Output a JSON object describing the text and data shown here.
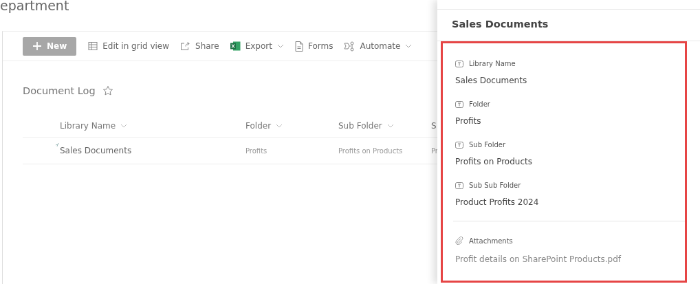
{
  "page_title": "epartment",
  "toolbar": [
    {
      "kind": "new",
      "label": "New"
    },
    {
      "kind": "grid",
      "label": "Edit in grid view"
    },
    {
      "kind": "share",
      "label": "Share"
    },
    {
      "kind": "excel",
      "label": "Export",
      "dropdown": true
    },
    {
      "kind": "forms",
      "label": "Forms"
    },
    {
      "kind": "automate",
      "label": "Automate",
      "dropdown": true
    }
  ],
  "list": {
    "title": "Document Log",
    "favorite": false,
    "columns": [
      {
        "label": "Library Name",
        "sortable": true
      },
      {
        "label": "Folder",
        "sortable": true
      },
      {
        "label": "Sub Folder",
        "sortable": true
      },
      {
        "label": "S",
        "sortable": false
      }
    ],
    "rows": [
      {
        "cells": [
          "Sales Documents",
          "Profits",
          "Profits on Products",
          "Pr"
        ],
        "new": true
      }
    ]
  },
  "panel": {
    "title": "Sales Documents",
    "fields": [
      {
        "kind": "text",
        "label": "Library Name",
        "value": "Sales Documents"
      },
      {
        "kind": "text",
        "label": "Folder",
        "value": "Profits"
      },
      {
        "kind": "text",
        "label": "Sub Folder",
        "value": "Profits on Products"
      },
      {
        "kind": "text",
        "label": "Sub Sub Folder",
        "value": "Product Profits 2024"
      },
      {
        "kind": "attachment",
        "label": "Attachments",
        "value": "Profit details on SharePoint Products.pdf"
      }
    ]
  }
}
